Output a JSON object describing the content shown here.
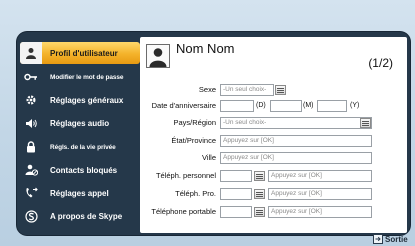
{
  "sidebar": {
    "items": [
      {
        "label": "Profil d'utilisateur",
        "icon": "person-icon",
        "active": true
      },
      {
        "label": "Modifier le mot de passe",
        "icon": "key-icon"
      },
      {
        "label": "Réglages généraux",
        "icon": "gear-icon"
      },
      {
        "label": "Réglages audio",
        "icon": "speaker-icon"
      },
      {
        "label": "Régls. de la vie privée",
        "icon": "lock-icon"
      },
      {
        "label": "Contacts bloqués",
        "icon": "blocked-contacts-icon"
      },
      {
        "label": "Réglages appel",
        "icon": "phone-forward-icon"
      },
      {
        "label": "A propos de Skype",
        "icon": "skype-icon"
      }
    ]
  },
  "profile": {
    "name": "Nom Nom",
    "page": "(1/2)",
    "sex_label": "Sexe",
    "sex_value": "-Un seul choix-",
    "birth_label": "Date d'anniversaire",
    "day_unit": "(D)",
    "month_unit": "(M)",
    "year_unit": "(Y)",
    "country_label": "Pays/Région",
    "country_value": "-Un seul choix-",
    "state_label": "État/Province",
    "state_placeholder": "Appuyez sur [OK]",
    "city_label": "Ville",
    "city_placeholder": "Appuyez sur [OK]",
    "home_phone_label": "Téléph. personnel",
    "home_phone_placeholder": "Appuyez sur [OK]",
    "office_phone_label": "Téléph. Pro.",
    "office_phone_placeholder": "Appuyez sur [OK]",
    "mobile_phone_label": "Téléphone portable",
    "mobile_phone_placeholder": "Appuyez sur [OK]"
  },
  "footer": {
    "exit_label": "Sortie"
  },
  "colors": {
    "accent": "#f4b22a",
    "frame": "#25384a",
    "background": "#c9dbea"
  }
}
